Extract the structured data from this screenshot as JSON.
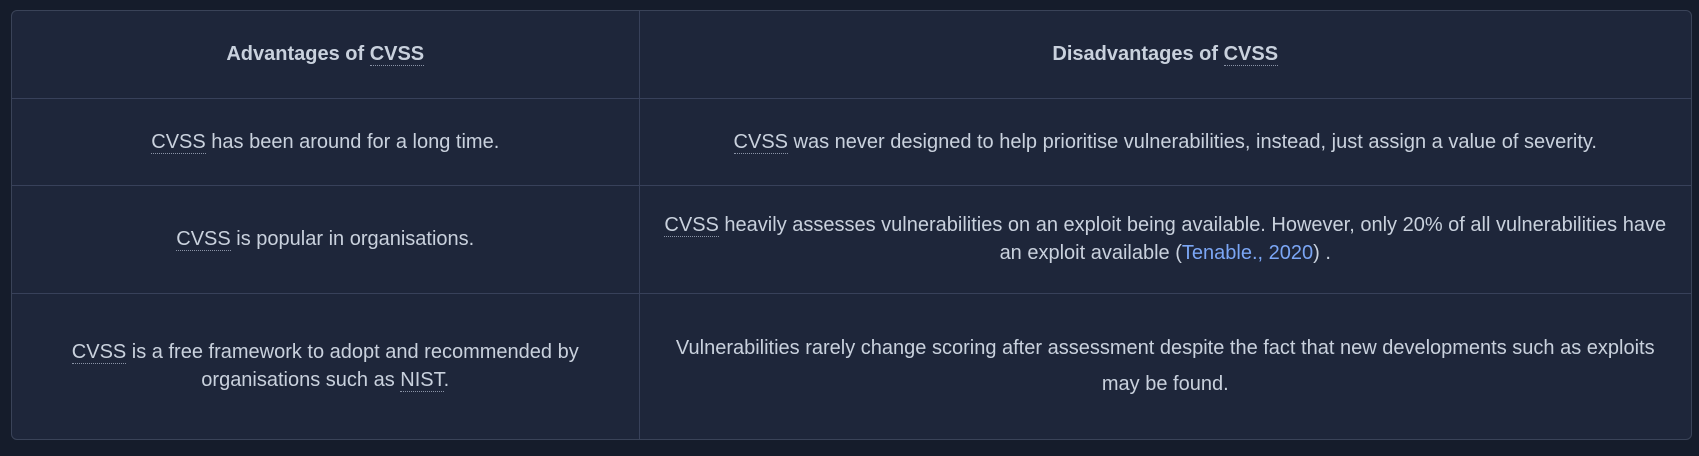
{
  "table": {
    "headers": {
      "advantages": {
        "prefix": "Advantages of ",
        "term": "CVSS"
      },
      "disadvantages": {
        "prefix": "Disadvantages of ",
        "term": "CVSS"
      }
    },
    "rows": [
      {
        "advantage": {
          "term": "CVSS",
          "text": " has been around for a long time."
        },
        "disadvantage": {
          "term": "CVSS",
          "text": " was never designed to help prioritise vulnerabilities, instead, just assign a value of severity."
        }
      },
      {
        "advantage": {
          "term": "CVSS",
          "text": " is popular in organisations."
        },
        "disadvantage": {
          "term": "CVSS",
          "text": " heavily assesses vulnerabilities on an exploit being available. However, only 20% of all vulnerabilities have an exploit available (",
          "link": "Tenable., 2020",
          "suffix": ") ."
        }
      },
      {
        "advantage": {
          "term": "CVSS",
          "text": " is a free framework to adopt and recommended by organisations such as ",
          "term2": "NIST",
          "suffix": "."
        },
        "disadvantage": {
          "text": "Vulnerabilities rarely change scoring after assessment despite the fact that new developments such as exploits may be found."
        }
      }
    ]
  }
}
